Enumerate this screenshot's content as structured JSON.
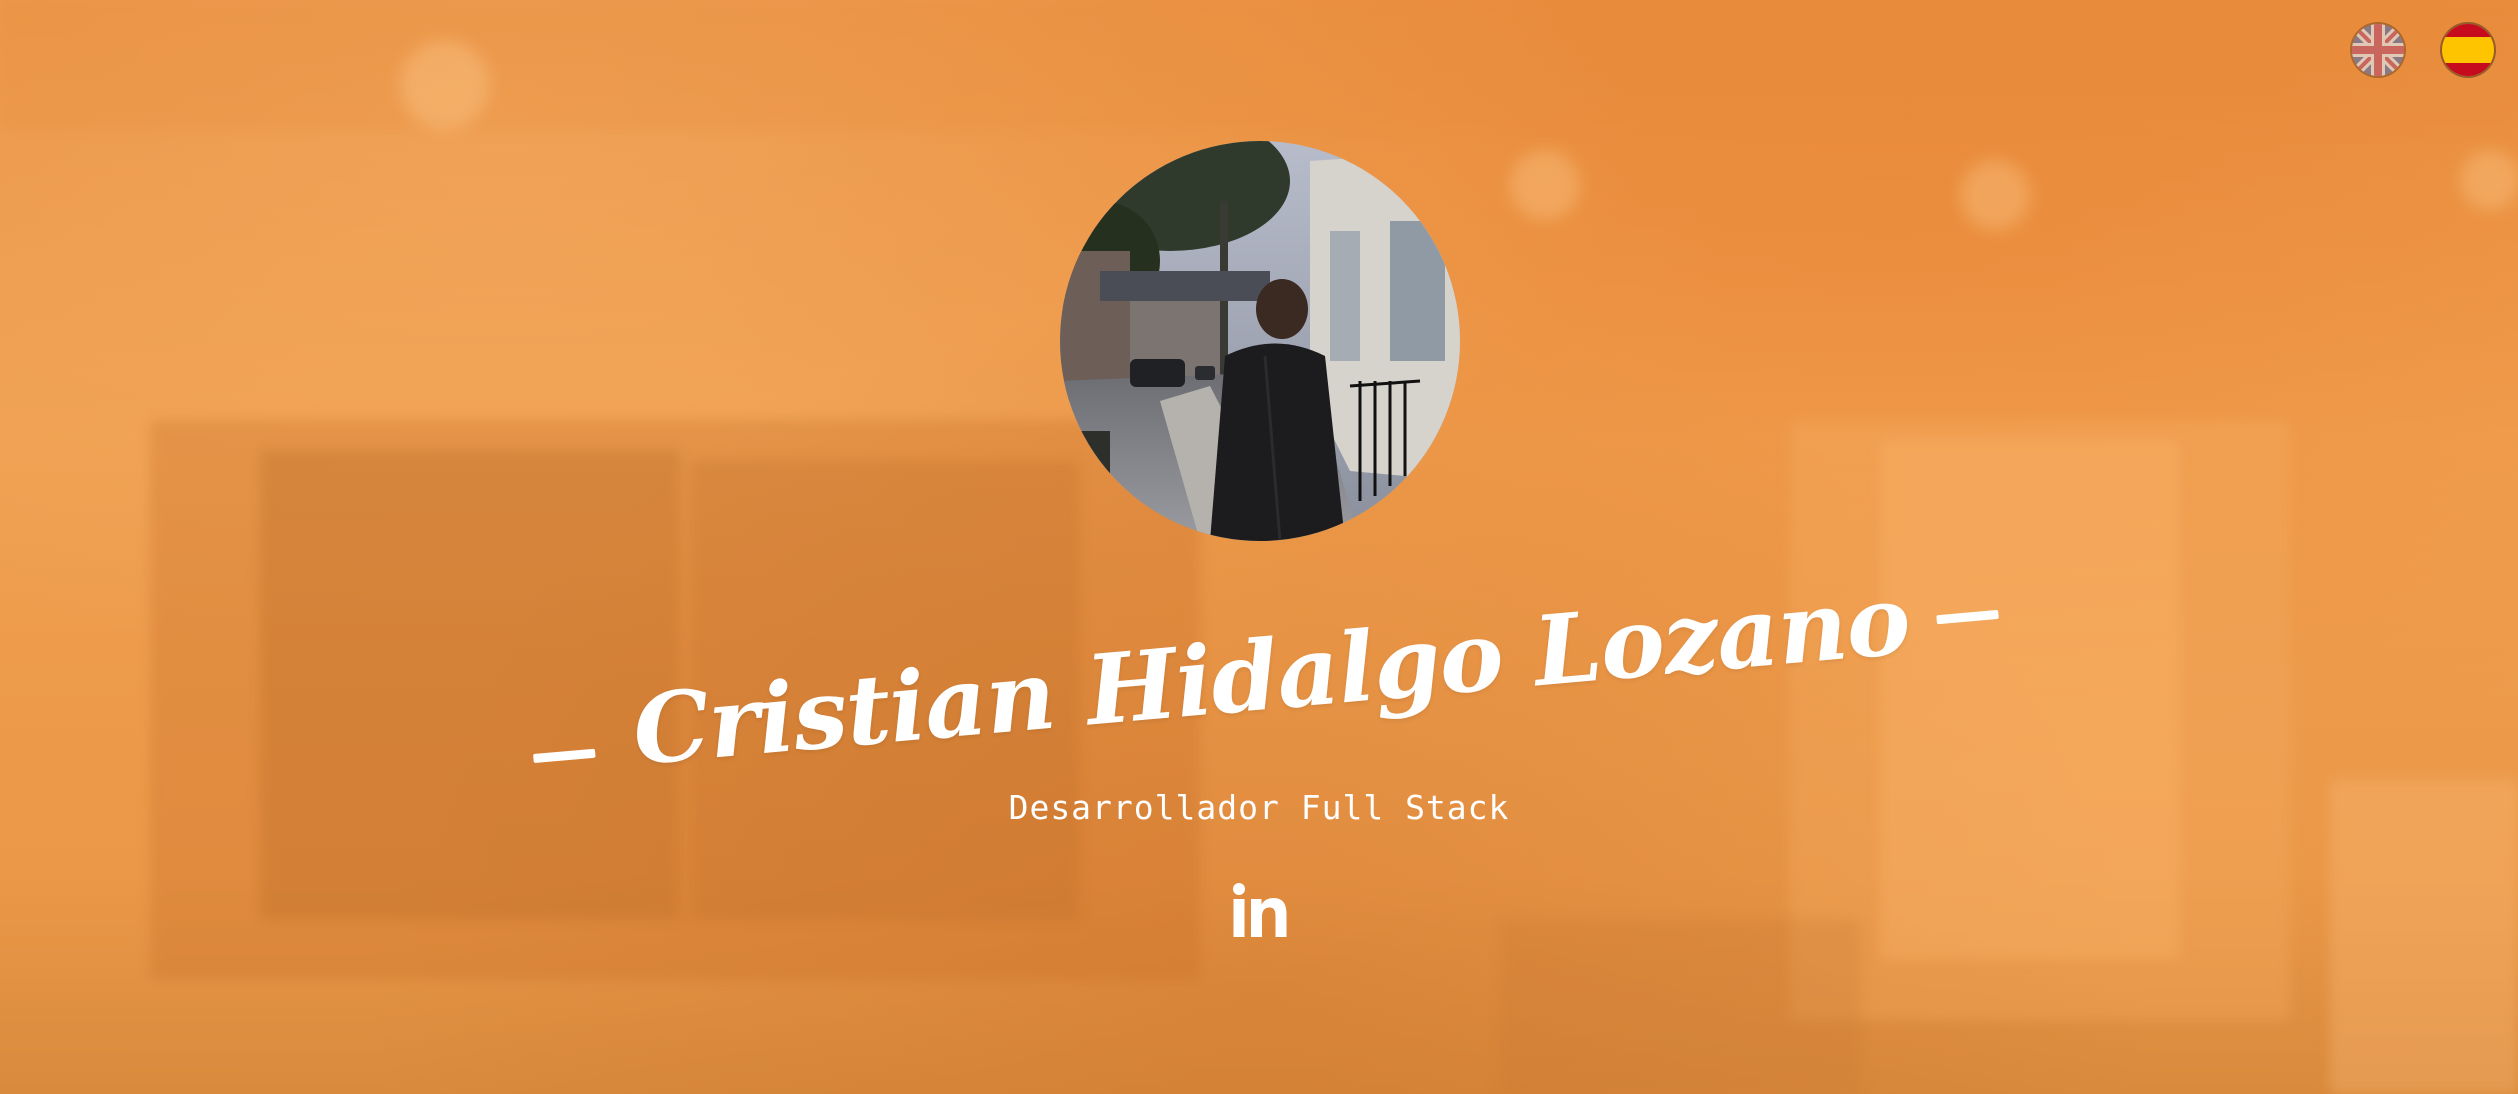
{
  "profile": {
    "name": "Cristian Hidalgo Lozano",
    "role": "Desarrollador Full Stack"
  },
  "language_switcher": {
    "options": [
      {
        "code": "en",
        "icon": "uk-flag-icon"
      },
      {
        "code": "es",
        "icon": "spain-flag-icon"
      }
    ],
    "selected": "es"
  },
  "social_links": [
    {
      "network": "LinkedIn",
      "icon": "linkedin-icon"
    }
  ],
  "colors": {
    "background_accent": "#ee9a4a",
    "text": "#ffffff"
  }
}
